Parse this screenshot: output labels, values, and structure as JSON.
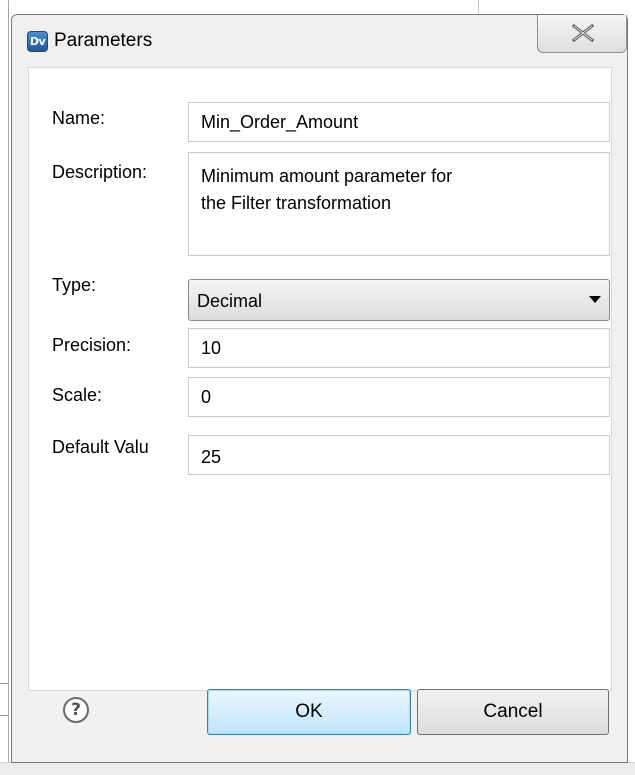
{
  "window": {
    "title": "Parameters",
    "app_icon_text": "Dv",
    "close_icon": "close-x-icon"
  },
  "form": {
    "name_label": "Name:",
    "name_value": "Min_Order_Amount",
    "description_label": "Description:",
    "description_value": "Minimum amount parameter for\nthe Filter transformation",
    "type_label": "Type:",
    "type_value": "Decimal",
    "precision_label": "Precision:",
    "precision_value": "10",
    "scale_label": "Scale:",
    "scale_value": "0",
    "default_label": "Default Valu",
    "default_value": "25"
  },
  "footer": {
    "help_icon": "help-icon",
    "help_glyph": "?",
    "ok_label": "OK",
    "cancel_label": "Cancel"
  },
  "colors": {
    "dialog_bg": "#f0f0f0",
    "ok_border": "#3c7fb1",
    "icon_blue": "#1d5a9c"
  }
}
